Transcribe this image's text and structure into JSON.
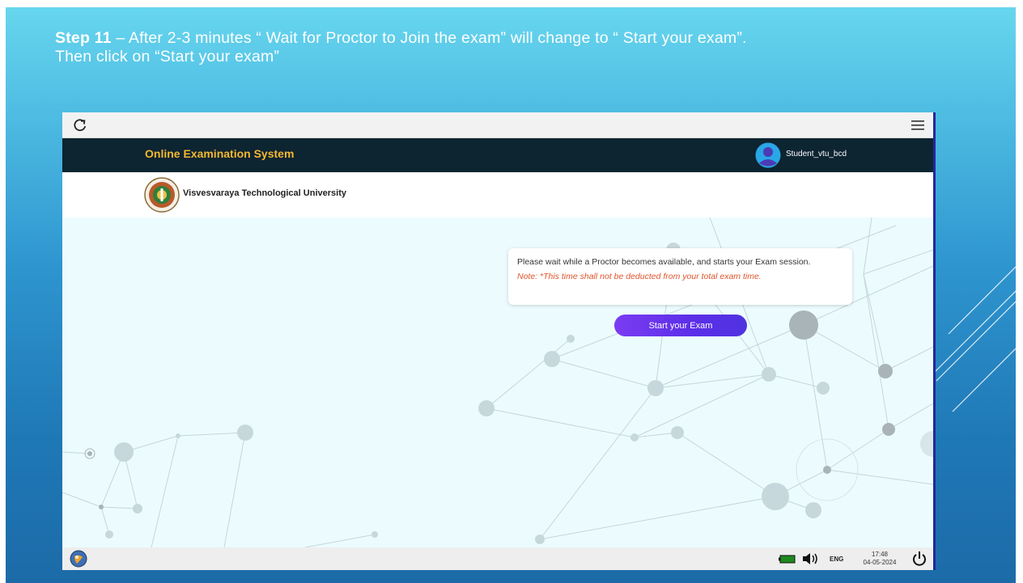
{
  "slide": {
    "step_label": "Step 11",
    "instruction_line1": " – After 2-3 minutes “ Wait for Proctor to Join the exam” will change to “ Start your exam”.",
    "instruction_line2": "Then click on “Start your exam”"
  },
  "app": {
    "title": "Online Examination System",
    "username": "Student_vtu_bcd",
    "university": "Visvesvaraya Technological University",
    "accent_color": "#f5b82e",
    "header_color": "#0d2431"
  },
  "notice": {
    "message": "Please wait while a Proctor becomes available, and starts your Exam session.",
    "note": "Note: *This time shall not be deducted from your total exam time."
  },
  "start_button": {
    "label": "Start your Exam",
    "color": "#6a35ee"
  },
  "browser_bar": {
    "reload_icon": "reload-icon",
    "menu_icon": "hamburger-menu-icon"
  },
  "taskbar": {
    "language": "ENG",
    "time": "17:48",
    "date": "04-05-2024",
    "icons": [
      "start-orb-icon",
      "battery-icon",
      "volume-icon",
      "power-icon"
    ]
  }
}
